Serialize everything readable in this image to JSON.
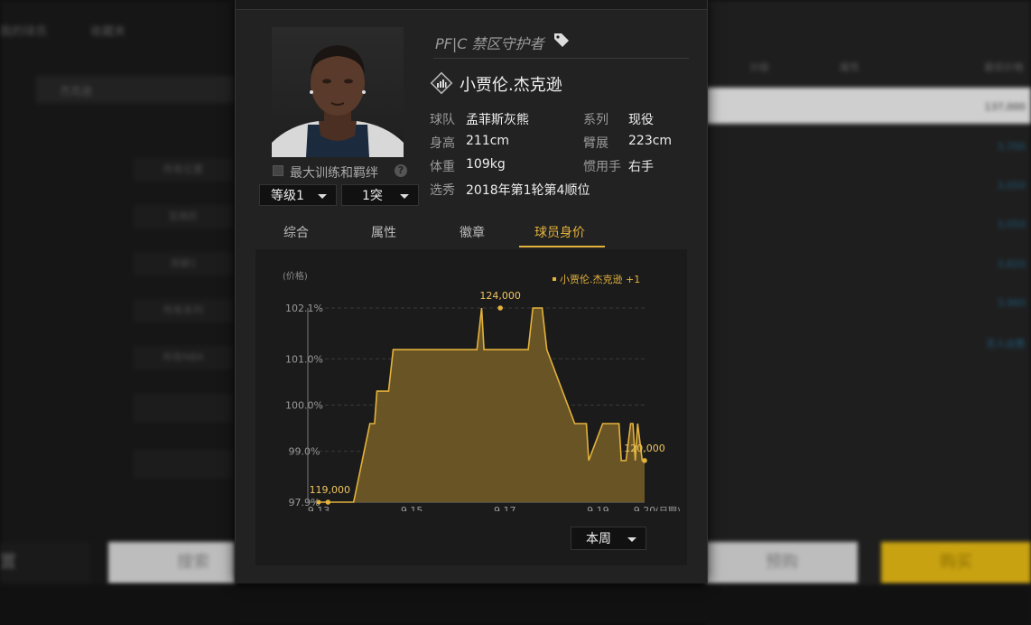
{
  "background": {
    "tabs": [
      "我的球员",
      "收藏夹"
    ],
    "search_value": "杰克逊",
    "filters": [
      "所有位置",
      "至高阶",
      "突破1",
      "所有系列",
      "所有NBA"
    ],
    "columns": [
      "分级",
      "属性",
      "最低价格"
    ],
    "prices": [
      "137,000",
      "3,700",
      "3,050",
      "3,050",
      "3,820",
      "3,960",
      "无人出售"
    ],
    "buttons": {
      "left_partial": "置",
      "search": "搜索",
      "preorder": "预购",
      "buy": "购买"
    }
  },
  "player": {
    "position_title": "PF|C 禁区守护者",
    "name": "小贾伦.杰克逊",
    "info": {
      "team_label": "球队",
      "team": "孟菲斯灰熊",
      "series_label": "系列",
      "series": "现役",
      "height_label": "身高",
      "height": "211cm",
      "wingspan_label": "臂展",
      "wingspan": "223cm",
      "weight_label": "体重",
      "weight": "109kg",
      "hand_label": "惯用手",
      "hand": "右手",
      "draft_label": "选秀",
      "draft": "2018年第1轮第4顺位"
    },
    "max_training_label": "最大训练和羁绊",
    "help_icon": "?",
    "level_select": "等级1",
    "break_select": "1突"
  },
  "tabs": {
    "overview": "综合",
    "attributes": "属性",
    "badges": "徽章",
    "value": "球员身价"
  },
  "chart_data": {
    "type": "area",
    "ylabel": "(价格)",
    "xlabel": "(日期)",
    "legend": "小贾伦.杰克逊 +1",
    "yticks": [
      "102.1%",
      "101.0%",
      "100.0%",
      "99.0%",
      "97.9%"
    ],
    "ytick_values": [
      102.1,
      101.0,
      100.0,
      99.0,
      97.9
    ],
    "ylim": [
      97.9,
      102.1
    ],
    "xticks": [
      "9.13",
      "9.15",
      "9.17",
      "9.19",
      "9.20"
    ],
    "xtick_values": [
      0,
      2,
      4,
      6,
      7
    ],
    "x": [
      0,
      0.2,
      0.4,
      0.45,
      0.55,
      0.6,
      0.75,
      1.1,
      1.2,
      1.25,
      1.5,
      1.6,
      1.7,
      2.0,
      2.2,
      2.3,
      3.4,
      3.5,
      3.55,
      3.6,
      4.0,
      4.2,
      4.3,
      4.5,
      4.6,
      4.7,
      4.8,
      4.9,
      5.5,
      5.7,
      5.75,
      5.8,
      6.1,
      6.2,
      6.45,
      6.5,
      6.6,
      6.7,
      6.75,
      6.8,
      6.85,
      6.95,
      7.0
    ],
    "values": [
      97.9,
      97.9,
      97.9,
      97.9,
      97.9,
      97.9,
      97.9,
      99.6,
      99.6,
      100.3,
      100.3,
      101.2,
      101.2,
      101.2,
      101.2,
      101.2,
      101.2,
      102.1,
      101.2,
      101.2,
      101.2,
      101.2,
      101.2,
      101.2,
      102.1,
      102.1,
      102.1,
      101.2,
      99.6,
      99.6,
      99.6,
      98.8,
      99.6,
      99.6,
      99.6,
      98.8,
      98.8,
      99.6,
      99.6,
      98.8,
      99.6,
      98.8,
      98.8
    ],
    "annotations": [
      {
        "x": 0.2,
        "y": 97.9,
        "label": "119,000"
      },
      {
        "x": 3.9,
        "y": 102.1,
        "label": "124,000"
      },
      {
        "x": 7.0,
        "y": 98.8,
        "label": "120,000"
      }
    ],
    "period_select": "本周",
    "colors": {
      "line": "#e3b23c",
      "fill": "#6e5726",
      "grid": "#3a3a3a"
    }
  }
}
